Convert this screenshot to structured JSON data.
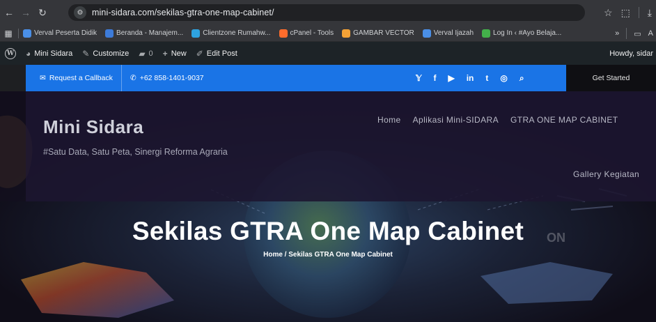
{
  "browser": {
    "url": "mini-sidara.com/sekilas-gtra-one-map-cabinet/",
    "bookmarks": [
      {
        "label": "Verval Peserta Didik",
        "color": "#4a8fe7"
      },
      {
        "label": "Beranda - Manajem...",
        "color": "#3d7bd9"
      },
      {
        "label": "Clientzone Rumahw...",
        "color": "#2ea3e0"
      },
      {
        "label": "cPanel - Tools",
        "color": "#ff6c2c"
      },
      {
        "label": "GAMBAR VECTOR",
        "color": "#f4a236"
      },
      {
        "label": "Verval Ijazah",
        "color": "#4a8fe7"
      },
      {
        "label": "Log In ‹ #Ayo Belaja...",
        "color": "#43b04a"
      }
    ],
    "more_label": "»",
    "folder_label": "A"
  },
  "wpbar": {
    "site": "Mini Sidara",
    "customize": "Customize",
    "comments": "0",
    "new": "New",
    "edit": "Edit Post",
    "howdy": "Howdy, sidar"
  },
  "topbar": {
    "callback": "Request a Callback",
    "phone": "+62 858-1401-9037",
    "get_started": "Get Started",
    "socials": [
      "twitter-icon",
      "facebook-icon",
      "youtube-icon",
      "linkedin-icon",
      "tumblr-icon",
      "instagram-icon",
      "search-icon"
    ],
    "social_glyphs": [
      "𝕐",
      "f",
      "▶",
      "in",
      "t",
      "◎",
      "⌕"
    ]
  },
  "site": {
    "title": "Mini Sidara",
    "tagline": "#Satu Data, Satu Peta, Sinergi Reforma Agraria",
    "menu": [
      "Home",
      "Aplikasi Mini-SIDARA",
      "GTRA ONE MAP CABINET"
    ],
    "menu_second": "Gallery Kegiatan"
  },
  "hero": {
    "title": "Sekilas GTRA One Map Cabinet",
    "breadcrumb": "Home /  Sekilas GTRA One Map Cabinet",
    "ghost": "ON"
  },
  "colors": {
    "accent": "#1a74e6",
    "admin_bar": "#1d2327"
  }
}
